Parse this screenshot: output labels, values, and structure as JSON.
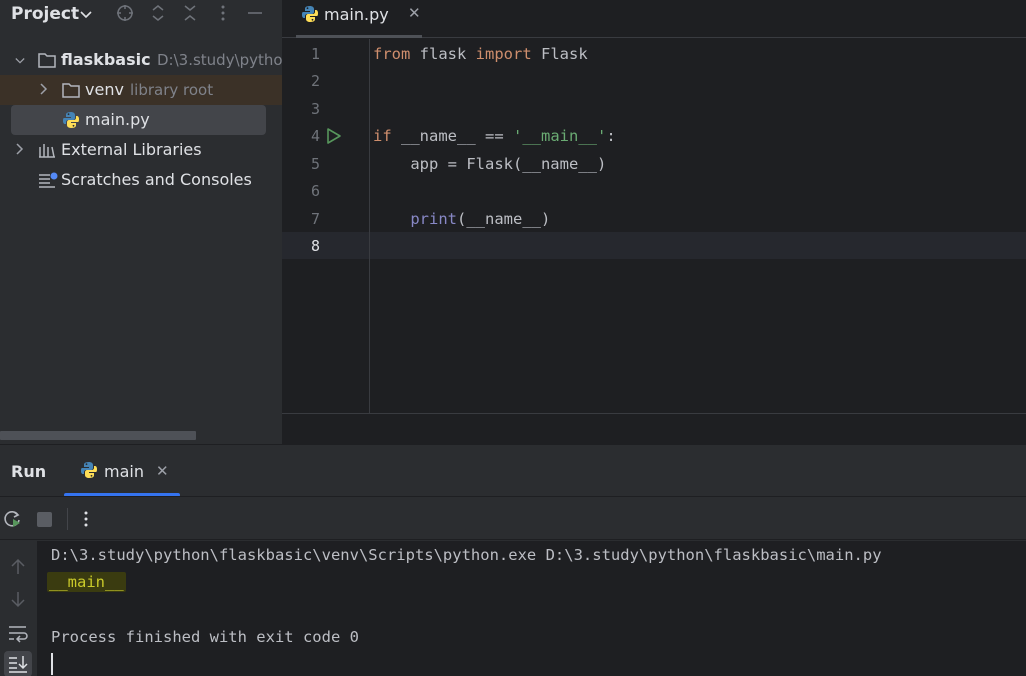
{
  "project_panel": {
    "title": "Project",
    "tree": {
      "root_name": "flaskbasic",
      "root_path": "D:\\3.study\\pytho",
      "venv_name": "venv",
      "venv_hint": "library root",
      "file_name": "main.py",
      "external_libraries": "External Libraries",
      "scratches": "Scratches and Consoles"
    }
  },
  "editor": {
    "tab_label": "main.py",
    "line_numbers": [
      "1",
      "2",
      "3",
      "4",
      "5",
      "6",
      "7",
      "8"
    ],
    "code": {
      "l1_from": "from",
      "l1_mid": " flask ",
      "l1_import": "import",
      "l1_end": " Flask",
      "l4_if": "if",
      "l4_mid": " __name__ == ",
      "l4_str": "'__main__'",
      "l4_end": ":",
      "l5": "    app = Flask(__name__)",
      "l7_indent": "    ",
      "l7_print": "print",
      "l7_end": "(__name__)"
    }
  },
  "run_window": {
    "title": "Run",
    "tab_label": "main",
    "console": {
      "command": "D:\\3.study\\python\\flaskbasic\\venv\\Scripts\\python.exe D:\\3.study\\python\\flaskbasic\\main.py",
      "output": "__main__",
      "exit_message": "Process finished with exit code 0"
    }
  },
  "colors": {
    "keyword": "#cf8e6d",
    "string": "#6aab73",
    "builtin": "#b200b2",
    "accent": "#3574f0"
  }
}
